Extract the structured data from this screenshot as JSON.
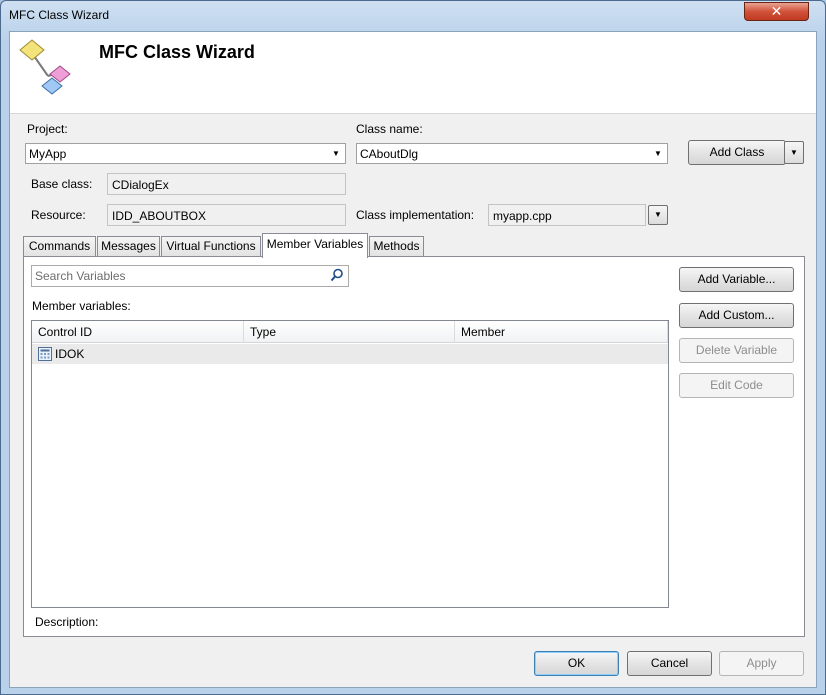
{
  "window": {
    "title": "MFC Class Wizard",
    "close_glyph": "✕"
  },
  "banner": {
    "title": "MFC Class Wizard",
    "icon": "class-wizard-icon"
  },
  "form": {
    "project_label": "Project:",
    "project_value": "MyApp",
    "class_name_label": "Class name:",
    "class_name_value": "CAboutDlg",
    "add_class_label": "Add Class",
    "base_class_label": "Base class:",
    "base_class_value": "CDialogEx",
    "resource_label": "Resource:",
    "resource_value": "IDD_ABOUTBOX",
    "class_impl_label": "Class implementation:",
    "class_impl_value": "myapp.cpp"
  },
  "tabs": [
    {
      "label": "Commands",
      "active": false
    },
    {
      "label": "Messages",
      "active": false
    },
    {
      "label": "Virtual Functions",
      "active": false
    },
    {
      "label": "Member Variables",
      "active": true
    },
    {
      "label": "Methods",
      "active": false
    }
  ],
  "member_variables": {
    "search_placeholder": "Search Variables",
    "list_label": "Member variables:",
    "columns": [
      "Control ID",
      "Type",
      "Member"
    ],
    "rows": [
      {
        "control_id": "IDOK",
        "type": "",
        "member": ""
      }
    ],
    "description_label": "Description:",
    "buttons": {
      "add_variable": "Add Variable...",
      "add_custom": "Add Custom...",
      "delete_variable": "Delete Variable",
      "edit_code": "Edit Code"
    }
  },
  "footer": {
    "ok": "OK",
    "cancel": "Cancel",
    "apply": "Apply"
  },
  "colors": {
    "accent": "#3c7fb1",
    "close_button": "#c03a22"
  }
}
